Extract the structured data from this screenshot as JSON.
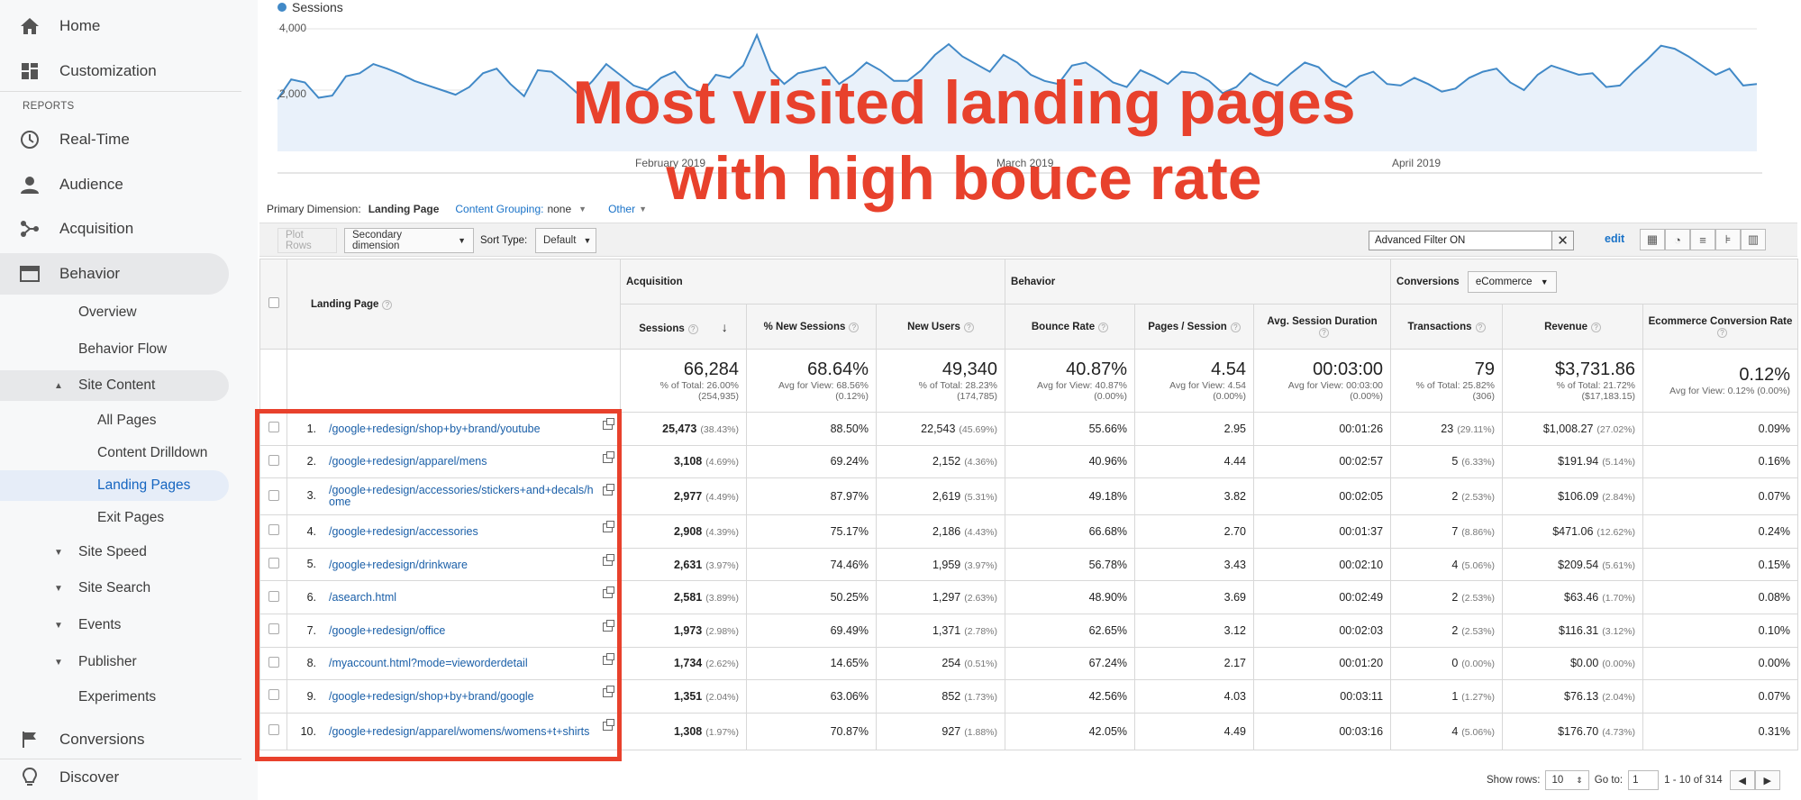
{
  "sidebar": {
    "home": "Home",
    "customization": "Customization",
    "reports_label": "REPORTS",
    "realtime": "Real-Time",
    "audience": "Audience",
    "acquisition": "Acquisition",
    "behavior": "Behavior",
    "behavior_items": [
      "Overview",
      "Behavior Flow",
      "Site Content"
    ],
    "site_content_items": [
      "All Pages",
      "Content Drilldown",
      "Landing Pages",
      "Exit Pages"
    ],
    "more_items": [
      "Site Speed",
      "Site Search",
      "Events",
      "Publisher",
      "Experiments"
    ],
    "conversions": "Conversions",
    "discover": "Discover"
  },
  "chart_data": {
    "type": "line",
    "series": [
      {
        "name": "Sessions",
        "values": [
          1700,
          2350,
          2250,
          1750,
          1820,
          2450,
          2550,
          2850,
          2700,
          2520,
          2300,
          2150,
          2000,
          1850,
          2100,
          2550,
          2700,
          2200,
          1800,
          2650,
          2600,
          2250,
          1850,
          2300,
          2850,
          2500,
          2150,
          2000,
          2400,
          2600,
          2100,
          1900,
          2500,
          2400,
          2800,
          3800,
          2650,
          2200,
          2550,
          2650,
          2750,
          2200,
          2500,
          2900,
          2650,
          2300,
          2300,
          2650,
          3150,
          3500,
          3100,
          2850,
          2600,
          3150,
          2900,
          2500,
          2300,
          2200,
          2800,
          2900,
          2600,
          2250,
          2100,
          2650,
          2450,
          2200,
          2600,
          2550,
          2300,
          1900,
          2100,
          2550,
          2300,
          2150,
          2550,
          2900,
          2750,
          2300,
          2100,
          2450,
          2600,
          2200,
          2150,
          2400,
          2200,
          1950,
          2050,
          2400,
          2600,
          2700,
          2250,
          2000,
          2500,
          2800,
          2650,
          2500,
          2550,
          2100,
          2150,
          2600,
          3000,
          3450,
          3350,
          3100,
          2800,
          2500,
          2700,
          2150,
          2200
        ]
      }
    ],
    "ylim": [
      0,
      4000
    ],
    "yticks": [
      "4,000",
      "2,000"
    ],
    "xticks": [
      "February 2019",
      "March 2019",
      "April 2019"
    ],
    "title": "",
    "xlabel": "",
    "ylabel": ""
  },
  "overlay": {
    "line1": "Most visited landing pages",
    "line2": "with high bouce rate"
  },
  "dimension_bar": {
    "primary_label": "Primary Dimension:",
    "primary_value": "Landing Page",
    "grouping_label": "Content Grouping:",
    "grouping_value": "none",
    "other": "Other"
  },
  "toolbar": {
    "plot_rows": "Plot Rows",
    "secondary_dimension": "Secondary dimension",
    "sort_type_label": "Sort Type:",
    "sort_type_value": "Default",
    "filter_value": "Advanced Filter ON",
    "edit": "edit"
  },
  "table": {
    "groups": {
      "acquisition": "Acquisition",
      "behavior": "Behavior",
      "conversions": "Conversions",
      "conversions_select": "eCommerce"
    },
    "landing_page_header": "Landing Page",
    "headers": [
      "Sessions",
      "% New Sessions",
      "New Users",
      "Bounce Rate",
      "Pages / Session",
      "Avg. Session Duration",
      "Transactions",
      "Revenue",
      "Ecommerce Conversion Rate"
    ],
    "totals": [
      {
        "big": "66,284",
        "small1": "% of Total: 26.00%",
        "small2": "(254,935)"
      },
      {
        "big": "68.64%",
        "small1": "Avg for View: 68.56%",
        "small2": "(0.12%)"
      },
      {
        "big": "49,340",
        "small1": "% of Total: 28.23%",
        "small2": "(174,785)"
      },
      {
        "big": "40.87%",
        "small1": "Avg for View: 40.87%",
        "small2": "(0.00%)"
      },
      {
        "big": "4.54",
        "small1": "Avg for View: 4.54",
        "small2": "(0.00%)"
      },
      {
        "big": "00:03:00",
        "small1": "Avg for View: 00:03:00",
        "small2": "(0.00%)"
      },
      {
        "big": "79",
        "small1": "% of Total: 25.82%",
        "small2": "(306)"
      },
      {
        "big": "$3,731.86",
        "small1": "% of Total: 21.72%",
        "small2": "($17,183.15)"
      },
      {
        "big": "0.12%",
        "small1": "Avg for View: 0.12% (0.00%)",
        "small2": ""
      }
    ],
    "rows": [
      {
        "num": "1.",
        "page": "/google+redesign/shop+by+brand/youtube",
        "sessions": "25,473",
        "sessions_pct": "(38.43%)",
        "new_sessions": "88.50%",
        "new_users": "22,543",
        "new_users_pct": "(45.69%)",
        "bounce": "55.66%",
        "pps": "2.95",
        "duration": "00:01:26",
        "transactions": "23",
        "transactions_pct": "(29.11%)",
        "revenue": "$1,008.27",
        "revenue_pct": "(27.02%)",
        "conv": "0.09%"
      },
      {
        "num": "2.",
        "page": "/google+redesign/apparel/mens",
        "sessions": "3,108",
        "sessions_pct": "(4.69%)",
        "new_sessions": "69.24%",
        "new_users": "2,152",
        "new_users_pct": "(4.36%)",
        "bounce": "40.96%",
        "pps": "4.44",
        "duration": "00:02:57",
        "transactions": "5",
        "transactions_pct": "(6.33%)",
        "revenue": "$191.94",
        "revenue_pct": "(5.14%)",
        "conv": "0.16%"
      },
      {
        "num": "3.",
        "page": "/google+redesign/accessories/stickers+and+decals/home",
        "sessions": "2,977",
        "sessions_pct": "(4.49%)",
        "new_sessions": "87.97%",
        "new_users": "2,619",
        "new_users_pct": "(5.31%)",
        "bounce": "49.18%",
        "pps": "3.82",
        "duration": "00:02:05",
        "transactions": "2",
        "transactions_pct": "(2.53%)",
        "revenue": "$106.09",
        "revenue_pct": "(2.84%)",
        "conv": "0.07%"
      },
      {
        "num": "4.",
        "page": "/google+redesign/accessories",
        "sessions": "2,908",
        "sessions_pct": "(4.39%)",
        "new_sessions": "75.17%",
        "new_users": "2,186",
        "new_users_pct": "(4.43%)",
        "bounce": "66.68%",
        "pps": "2.70",
        "duration": "00:01:37",
        "transactions": "7",
        "transactions_pct": "(8.86%)",
        "revenue": "$471.06",
        "revenue_pct": "(12.62%)",
        "conv": "0.24%"
      },
      {
        "num": "5.",
        "page": "/google+redesign/drinkware",
        "sessions": "2,631",
        "sessions_pct": "(3.97%)",
        "new_sessions": "74.46%",
        "new_users": "1,959",
        "new_users_pct": "(3.97%)",
        "bounce": "56.78%",
        "pps": "3.43",
        "duration": "00:02:10",
        "transactions": "4",
        "transactions_pct": "(5.06%)",
        "revenue": "$209.54",
        "revenue_pct": "(5.61%)",
        "conv": "0.15%"
      },
      {
        "num": "6.",
        "page": "/asearch.html",
        "sessions": "2,581",
        "sessions_pct": "(3.89%)",
        "new_sessions": "50.25%",
        "new_users": "1,297",
        "new_users_pct": "(2.63%)",
        "bounce": "48.90%",
        "pps": "3.69",
        "duration": "00:02:49",
        "transactions": "2",
        "transactions_pct": "(2.53%)",
        "revenue": "$63.46",
        "revenue_pct": "(1.70%)",
        "conv": "0.08%"
      },
      {
        "num": "7.",
        "page": "/google+redesign/office",
        "sessions": "1,973",
        "sessions_pct": "(2.98%)",
        "new_sessions": "69.49%",
        "new_users": "1,371",
        "new_users_pct": "(2.78%)",
        "bounce": "62.65%",
        "pps": "3.12",
        "duration": "00:02:03",
        "transactions": "2",
        "transactions_pct": "(2.53%)",
        "revenue": "$116.31",
        "revenue_pct": "(3.12%)",
        "conv": "0.10%"
      },
      {
        "num": "8.",
        "page": "/myaccount.html?mode=vieworderdetail",
        "sessions": "1,734",
        "sessions_pct": "(2.62%)",
        "new_sessions": "14.65%",
        "new_users": "254",
        "new_users_pct": "(0.51%)",
        "bounce": "67.24%",
        "pps": "2.17",
        "duration": "00:01:20",
        "transactions": "0",
        "transactions_pct": "(0.00%)",
        "revenue": "$0.00",
        "revenue_pct": "(0.00%)",
        "conv": "0.00%"
      },
      {
        "num": "9.",
        "page": "/google+redesign/shop+by+brand/google",
        "sessions": "1,351",
        "sessions_pct": "(2.04%)",
        "new_sessions": "63.06%",
        "new_users": "852",
        "new_users_pct": "(1.73%)",
        "bounce": "42.56%",
        "pps": "4.03",
        "duration": "00:03:11",
        "transactions": "1",
        "transactions_pct": "(1.27%)",
        "revenue": "$76.13",
        "revenue_pct": "(2.04%)",
        "conv": "0.07%"
      },
      {
        "num": "10.",
        "page": "/google+redesign/apparel/womens/womens+t+shirts",
        "sessions": "1,308",
        "sessions_pct": "(1.97%)",
        "new_sessions": "70.87%",
        "new_users": "927",
        "new_users_pct": "(1.88%)",
        "bounce": "42.05%",
        "pps": "4.49",
        "duration": "00:03:16",
        "transactions": "4",
        "transactions_pct": "(5.06%)",
        "revenue": "$176.70",
        "revenue_pct": "(4.73%)",
        "conv": "0.31%"
      }
    ]
  },
  "pagination": {
    "show_rows_label": "Show rows:",
    "show_rows_value": "10",
    "goto_label": "Go to:",
    "goto_value": "1",
    "range": "1 - 10 of 314"
  },
  "colors": {
    "accent": "#e8412c",
    "line": "#4189c7",
    "link": "#1a5fa8"
  }
}
